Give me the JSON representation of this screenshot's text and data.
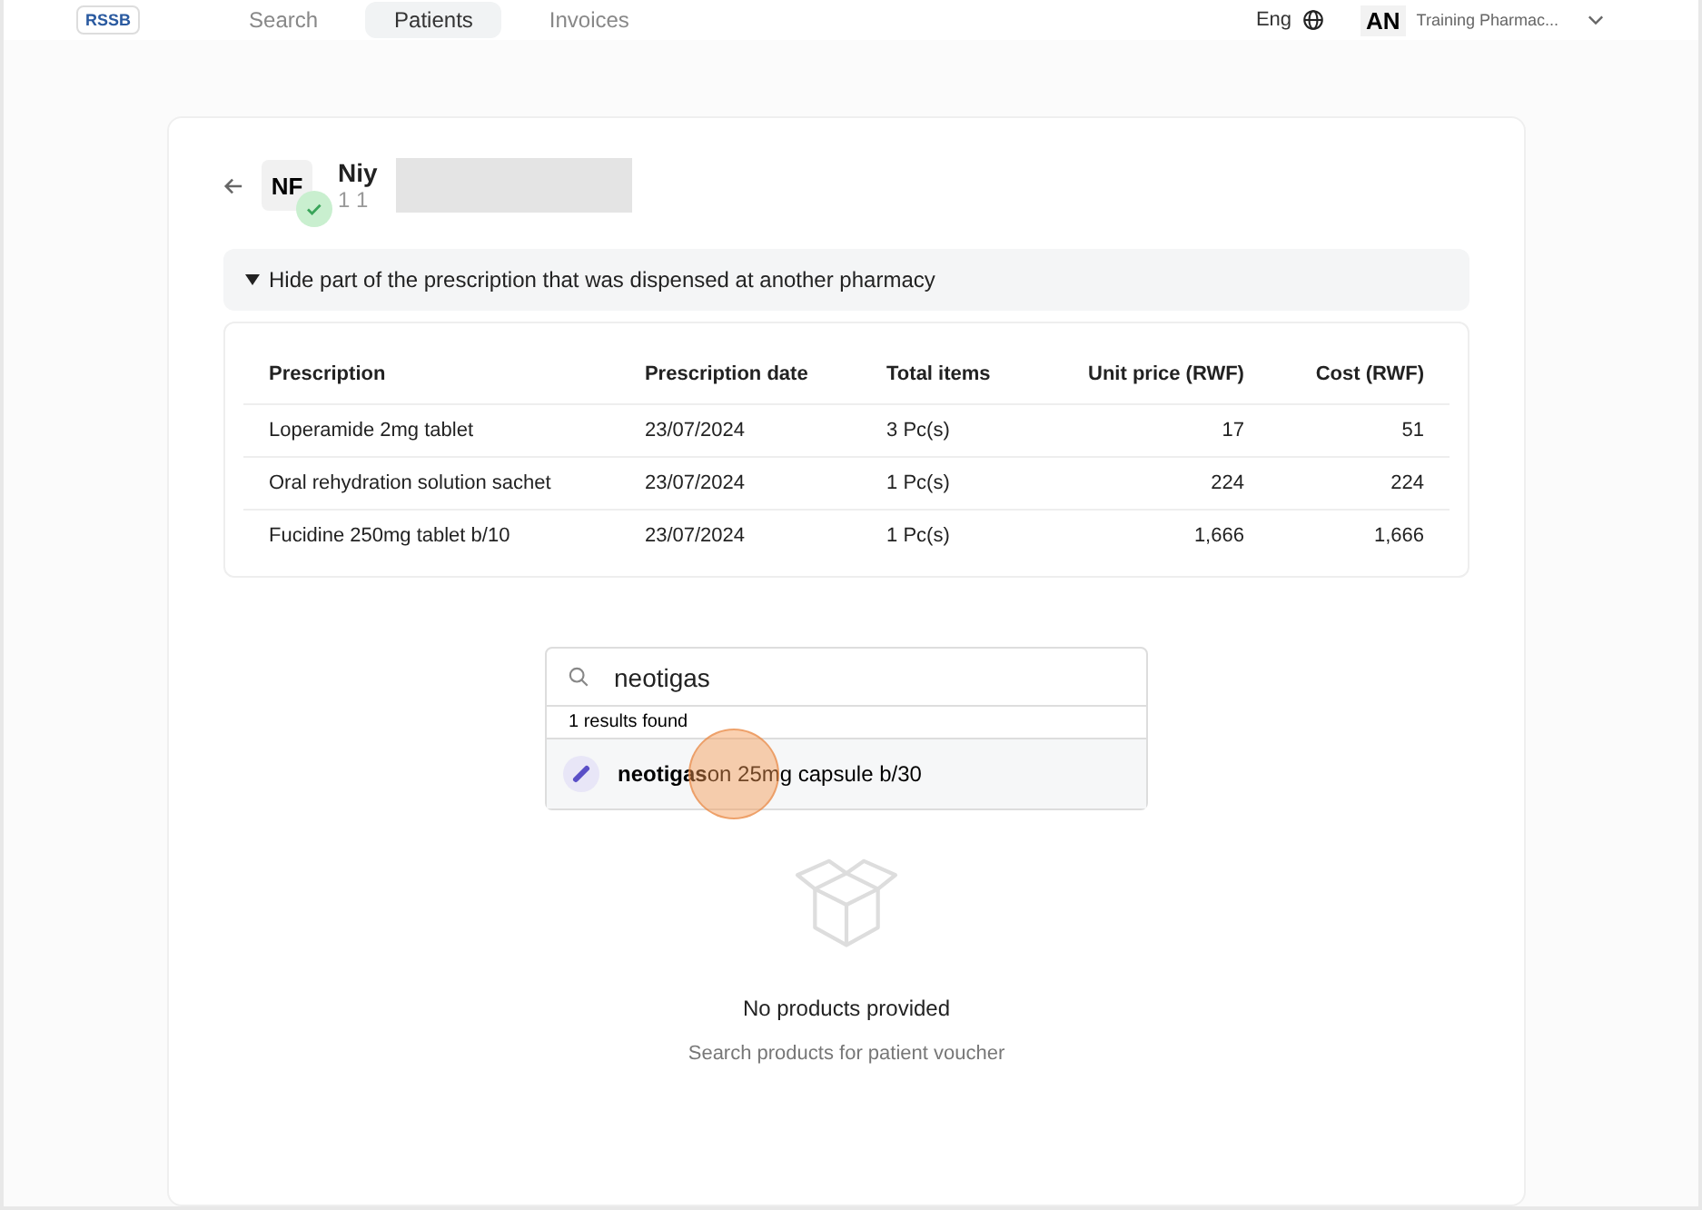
{
  "nav": {
    "logo": "RSSB",
    "tabs": [
      {
        "label": "Search",
        "selected": false
      },
      {
        "label": "Patients",
        "selected": true
      },
      {
        "label": "Invoices",
        "selected": false
      }
    ],
    "language": "Eng",
    "user": {
      "initials": "AN",
      "role": "Training Pharmac..."
    }
  },
  "patient": {
    "initials": "NF",
    "verified": true,
    "name": "Niy",
    "id": "1 1"
  },
  "toggle": {
    "label": "Hide part of the prescription that was dispensed at another pharmacy",
    "expanded": true
  },
  "table": {
    "columns": [
      "Prescription",
      "Prescription date",
      "Total items",
      "Unit price (RWF)",
      "Cost (RWF)"
    ],
    "rows": [
      [
        "Loperamide 2mg tablet",
        "23/07/2024",
        "3 Pc(s)",
        "17",
        "51"
      ],
      [
        "Oral rehydration solution sachet",
        "23/07/2024",
        "1 Pc(s)",
        "224",
        "224"
      ],
      [
        "Fucidine 250mg tablet b/10",
        "23/07/2024",
        "1 Pc(s)",
        "1,666",
        "1,666"
      ]
    ]
  },
  "search": {
    "value": "neotigas",
    "results_count": "1 results found",
    "results": [
      {
        "label": "**neotigas**on 25mg capsule b/30"
      }
    ]
  },
  "empty": {
    "title": "No products provided",
    "subtitle": "Search products for patient voucher"
  }
}
